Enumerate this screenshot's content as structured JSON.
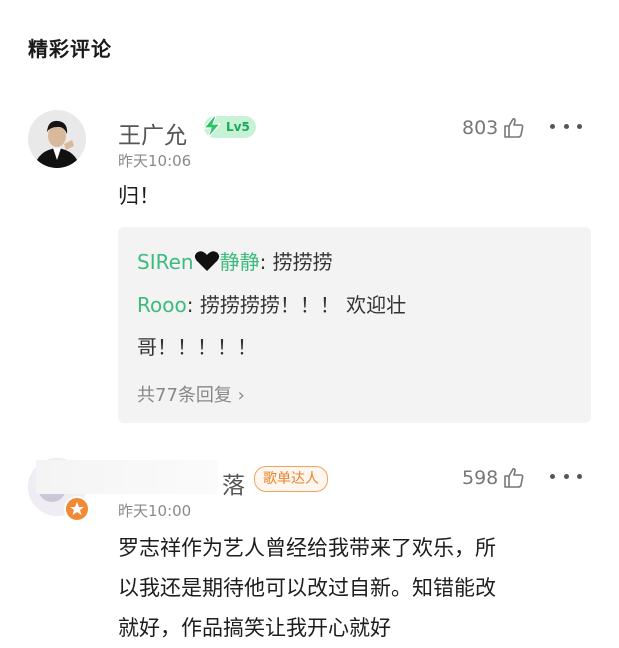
{
  "section": {
    "title": "精彩评论"
  },
  "comments": [
    {
      "username": "王广允",
      "level": "Lv5",
      "time": "昨天10:06",
      "likes": "803",
      "text": "归！",
      "replies": [
        {
          "name": "SIRen",
          "name2": "静静",
          "text": ": 捞捞捞"
        },
        {
          "name": "Rooo",
          "text": ": 捞捞捞捞！！！ 欢迎壮",
          "text2": "哥！！！！！"
        }
      ],
      "reply_more": "共77条回复 ›"
    },
    {
      "username": "落",
      "tag": "歌单达人",
      "time": "昨天10:00",
      "likes": "598",
      "text_lines": [
        "罗志祥作为艺人曾经给我带来了欢乐，所",
        "以我还是期待他可以改过自新。知错能改",
        "就好，作品搞笑让我开心就好"
      ]
    }
  ],
  "icons": [
    "thumb-up-icon",
    "more-icon",
    "lightning-icon",
    "heart-icon",
    "star-badge-icon"
  ],
  "colors": {
    "accent_green": "#3dba7e",
    "tag_orange": "#e8832c"
  }
}
